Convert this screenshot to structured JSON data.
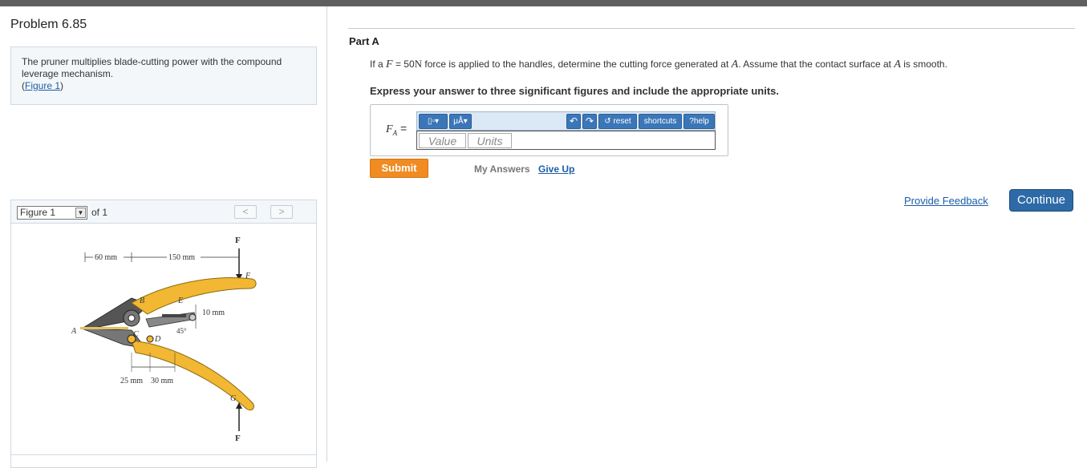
{
  "problem": {
    "title": "Problem 6.85",
    "description": "The pruner multiplies blade-cutting power with the compound leverage mechanism.",
    "figure_link_open": "(",
    "figure_link_text": "Figure 1",
    "figure_link_close": ")"
  },
  "figure": {
    "select_value": "Figure 1",
    "of_text": "of 1",
    "prev": "<",
    "next": ">",
    "labels": {
      "F_top": "F",
      "F_top_small": "F",
      "dim_60": "60 mm",
      "dim_150": "150 mm",
      "B": "B",
      "E": "E",
      "dim_10": "10 mm",
      "A": "A",
      "C": "C",
      "D": "D",
      "angle": "45°",
      "dim_25": "25 mm",
      "dim_30": "30 mm",
      "G": "G",
      "F_bottom": "F"
    }
  },
  "part": {
    "label": "Part A",
    "question_pre": "If a",
    "question_F": "F",
    "question_eq": "= 50",
    "question_N": "N",
    "question_mid": "force is applied to the handles, determine the cutting force generated at",
    "question_A": "A",
    "question_post": ". Assume that the contact surface at",
    "question_A2": "A",
    "question_end": "is smooth.",
    "instruction": "Express your answer to three significant figures and include the appropriate units."
  },
  "answer": {
    "var": "F",
    "var_sub": "A",
    "eq": "=",
    "toolbar": {
      "template": "▯▫▾",
      "units": "μÅ▾",
      "undo": "↶",
      "redo": "↷",
      "reset": "reset",
      "shortcuts": "shortcuts",
      "help": "help",
      "reset_icon": "↺",
      "help_icon": "?"
    },
    "value_placeholder": "Value",
    "units_placeholder": "Units"
  },
  "actions": {
    "submit": "Submit",
    "my_answers": "My Answers",
    "give_up": "Give Up",
    "feedback": "Provide Feedback",
    "continue": "Continue"
  },
  "colors": {
    "handle": "#f2b733",
    "submit": "#f08c22",
    "continue": "#2d6aa7",
    "link": "#1b5ea8"
  }
}
